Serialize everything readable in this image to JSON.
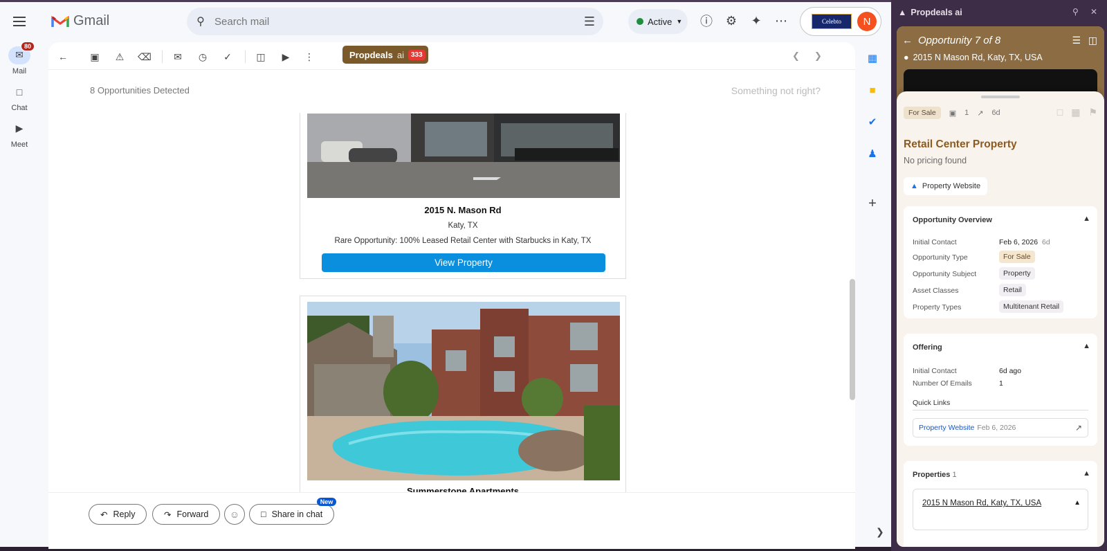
{
  "gmail": {
    "app_name": "Gmail",
    "search_placeholder": "Search mail",
    "status": "Active",
    "account_logo_text": "Celebto",
    "avatar_letter": "N"
  },
  "rail": {
    "items": [
      {
        "label": "Mail",
        "badge": "80"
      },
      {
        "label": "Chat"
      },
      {
        "label": "Meet"
      }
    ]
  },
  "toolbar": {
    "propdeals_label": "Propdeals",
    "propdeals_ai": "ai",
    "propdeals_count": "333"
  },
  "opportunities": {
    "detected": "8 Opportunities Detected",
    "feedback": "Something not right?"
  },
  "email": {
    "card1": {
      "title": "2015 N. Mason Rd",
      "city": "Katy, TX",
      "description": "Rare Opportunity: 100% Leased Retail Center with Starbucks in Katy, TX",
      "button": "View Property"
    },
    "card2": {
      "title": "Summerstone Apartments"
    }
  },
  "reply": {
    "reply": "Reply",
    "forward": "Forward",
    "share": "Share in chat",
    "new_badge": "New"
  },
  "panel": {
    "title": "Propdeals ai",
    "opportunity": "Opportunity 7 of 8",
    "address": "2015 N Mason Rd, Katy, TX, USA",
    "sale_chip": "For Sale",
    "email_count": "1",
    "age": "6d",
    "property_title": "Retail Center Property",
    "pricing": "No pricing found",
    "website_chip": "Property Website",
    "overview": {
      "heading": "Opportunity Overview",
      "rows": [
        {
          "k": "Initial Contact",
          "v": "Feb 6, 2026",
          "extra": "6d"
        },
        {
          "k": "Opportunity Type",
          "v": "For Sale"
        },
        {
          "k": "Opportunity Subject",
          "v": "Property"
        },
        {
          "k": "Asset Classes",
          "v": "Retail"
        },
        {
          "k": "Property Types",
          "v": "Multitenant Retail"
        }
      ]
    },
    "offering": {
      "heading": "Offering",
      "rows": [
        {
          "k": "Initial Contact",
          "v": "6d ago"
        },
        {
          "k": "Number Of Emails",
          "v": "1"
        }
      ],
      "quick_links": "Quick Links",
      "link_label": "Property Website",
      "link_date": "Feb 6, 2026"
    },
    "properties": {
      "heading": "Properties",
      "count": "1",
      "address": "2015 N Mason Rd, Katy, TX, USA"
    }
  }
}
